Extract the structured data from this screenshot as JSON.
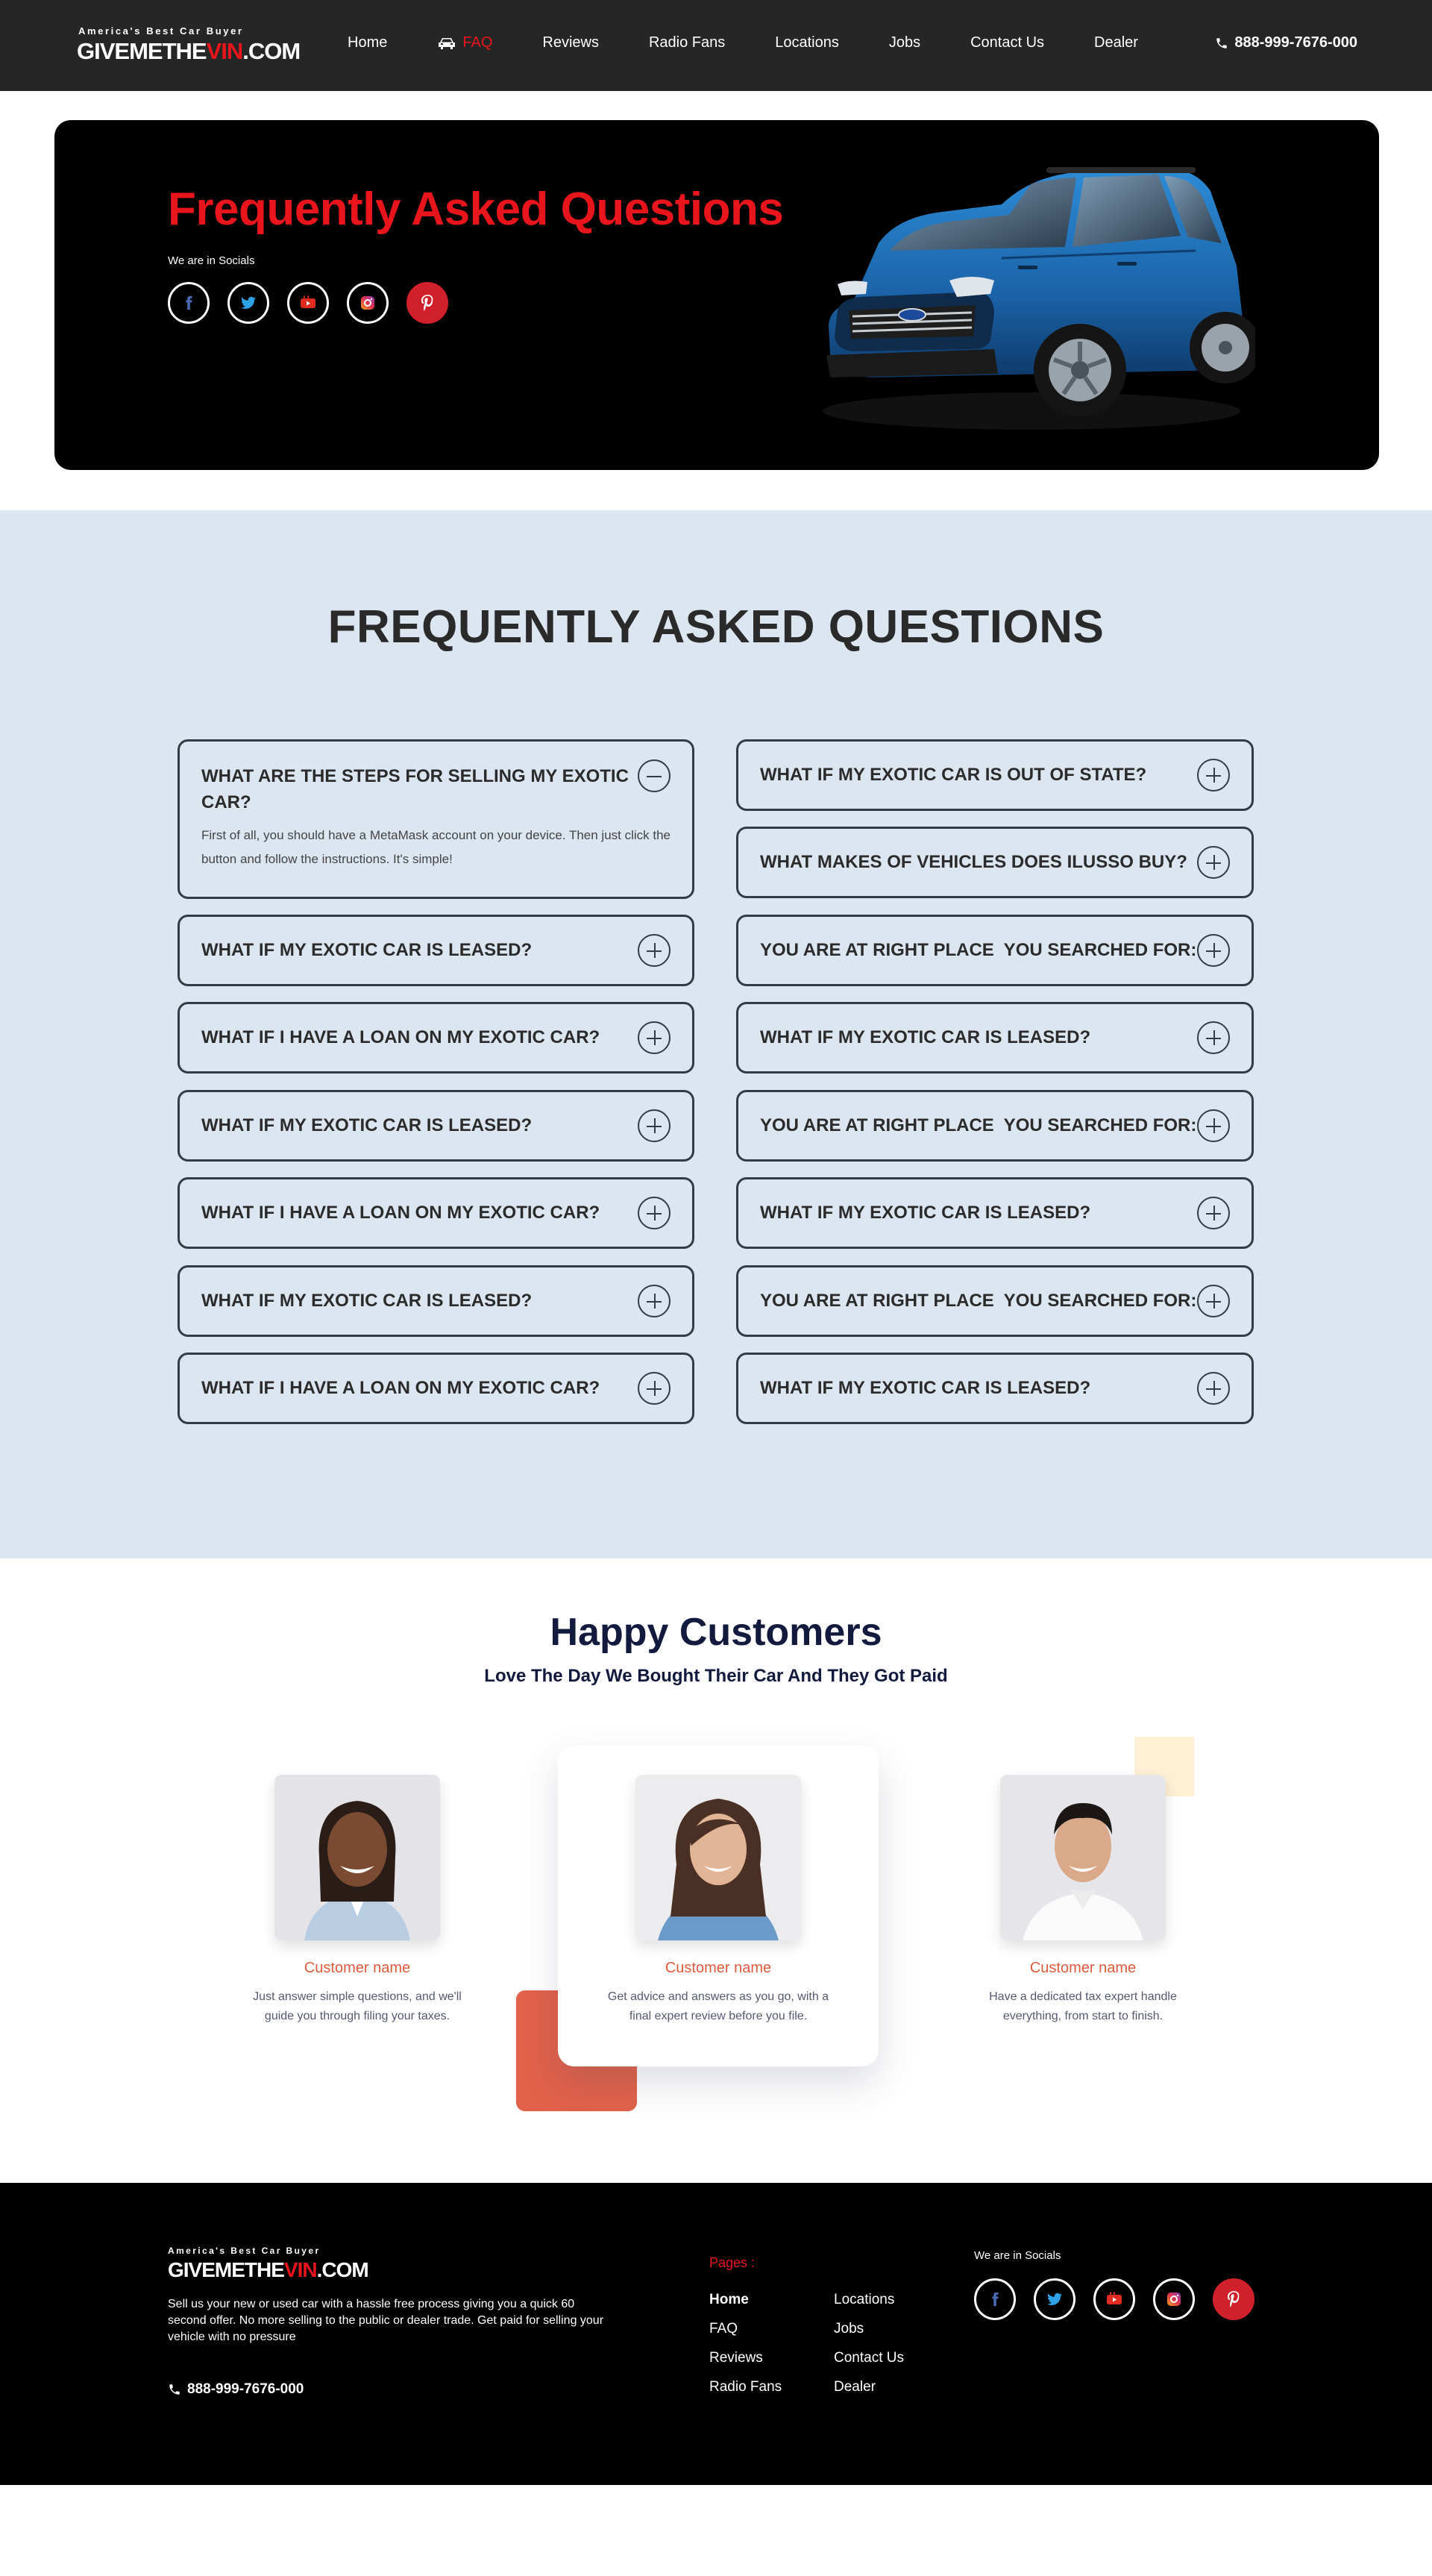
{
  "nav": {
    "logo_tag": "America's Best Car Buyer",
    "logo_part1": "GIVEMETHE",
    "logo_part2": "VIN",
    "logo_part3": ".COM",
    "items": [
      {
        "label": "Home"
      },
      {
        "label": "FAQ"
      },
      {
        "label": "Reviews"
      },
      {
        "label": "Radio Fans"
      },
      {
        "label": "Locations"
      },
      {
        "label": "Jobs"
      },
      {
        "label": "Contact Us"
      },
      {
        "label": "Dealer"
      }
    ],
    "active_item": "FAQ",
    "phone": "888-999-7676-000"
  },
  "hero": {
    "title": "Frequently Asked Questions",
    "socials_label": "We are in Socials",
    "socials": [
      "facebook-icon",
      "twitter-icon",
      "youtube-icon",
      "instagram-icon",
      "pinterest-icon"
    ]
  },
  "faq": {
    "title": "FREQUENTLY ASKED QUESTIONS",
    "left": [
      {
        "q_line1": "WHAT ARE THE STEPS FOR SELLING MY EXOTIC",
        "q_line2": "CAR?",
        "answer": "First of all, you should have a MetaMask account on your device. Then just click the button and follow the instructions. It's simple!",
        "open": true
      },
      {
        "q": "WHAT IF MY EXOTIC CAR IS LEASED?"
      },
      {
        "q": "WHAT IF I HAVE A LOAN ON MY EXOTIC CAR?"
      },
      {
        "q": "WHAT IF MY EXOTIC CAR IS LEASED?"
      },
      {
        "q": "WHAT IF I HAVE A LOAN ON MY EXOTIC CAR?"
      },
      {
        "q": "WHAT IF MY EXOTIC CAR IS LEASED?"
      },
      {
        "q": "WHAT IF I HAVE A LOAN ON MY EXOTIC CAR?"
      }
    ],
    "right": [
      {
        "q": "WHAT IF MY EXOTIC CAR IS OUT OF STATE?"
      },
      {
        "q": "WHAT MAKES OF VEHICLES DOES ILUSSO BUY?"
      },
      {
        "q": "YOU ARE AT RIGHT PLACE  YOU SEARCHED FOR:"
      },
      {
        "q": "WHAT IF MY EXOTIC CAR IS LEASED?"
      },
      {
        "q": "YOU ARE AT RIGHT PLACE  YOU SEARCHED FOR:"
      },
      {
        "q": "WHAT IF MY EXOTIC CAR IS LEASED?"
      },
      {
        "q": "YOU ARE AT RIGHT PLACE  YOU SEARCHED FOR:"
      },
      {
        "q": "WHAT IF MY EXOTIC CAR IS LEASED?"
      }
    ]
  },
  "customers": {
    "title": "Happy Customers",
    "subtitle": "Love The Day We Bought Their Car And They Got Paid",
    "items": [
      {
        "name": "Customer name",
        "line1": "Just answer simple questions, and we'll",
        "line2": "guide you through filing your taxes."
      },
      {
        "name": "Customer name",
        "line1": "Get advice and answers as you go, with a",
        "line2": "final expert review before you file."
      },
      {
        "name": "Customer name",
        "line1": "Have a dedicated tax expert handle",
        "line2": "everything, from start to finish."
      }
    ]
  },
  "footer": {
    "logo_tag": "America's Best Car Buyer",
    "logo_part1": "GIVEMETHE",
    "logo_part2": "VIN",
    "logo_part3": ".COM",
    "description": "Sell us your new or used car with a hassle free process giving you a quick 60 second offer. No more selling to the public or dealer trade. Get paid for selling your vehicle with no pressure",
    "phone": "888-999-7676-000",
    "pages_label": "Pages :",
    "pages_col1": [
      "Home",
      "FAQ",
      "Reviews",
      "Radio Fans"
    ],
    "pages_col2": [
      "Locations",
      "Jobs",
      "Contact Us",
      "Dealer"
    ],
    "socials_label": "We are in Socials"
  },
  "colors": {
    "accent_red": "#e8151c",
    "nav_bg": "#262626",
    "faq_bg": "#dce6f1",
    "customer_name": "#e05a3f"
  }
}
